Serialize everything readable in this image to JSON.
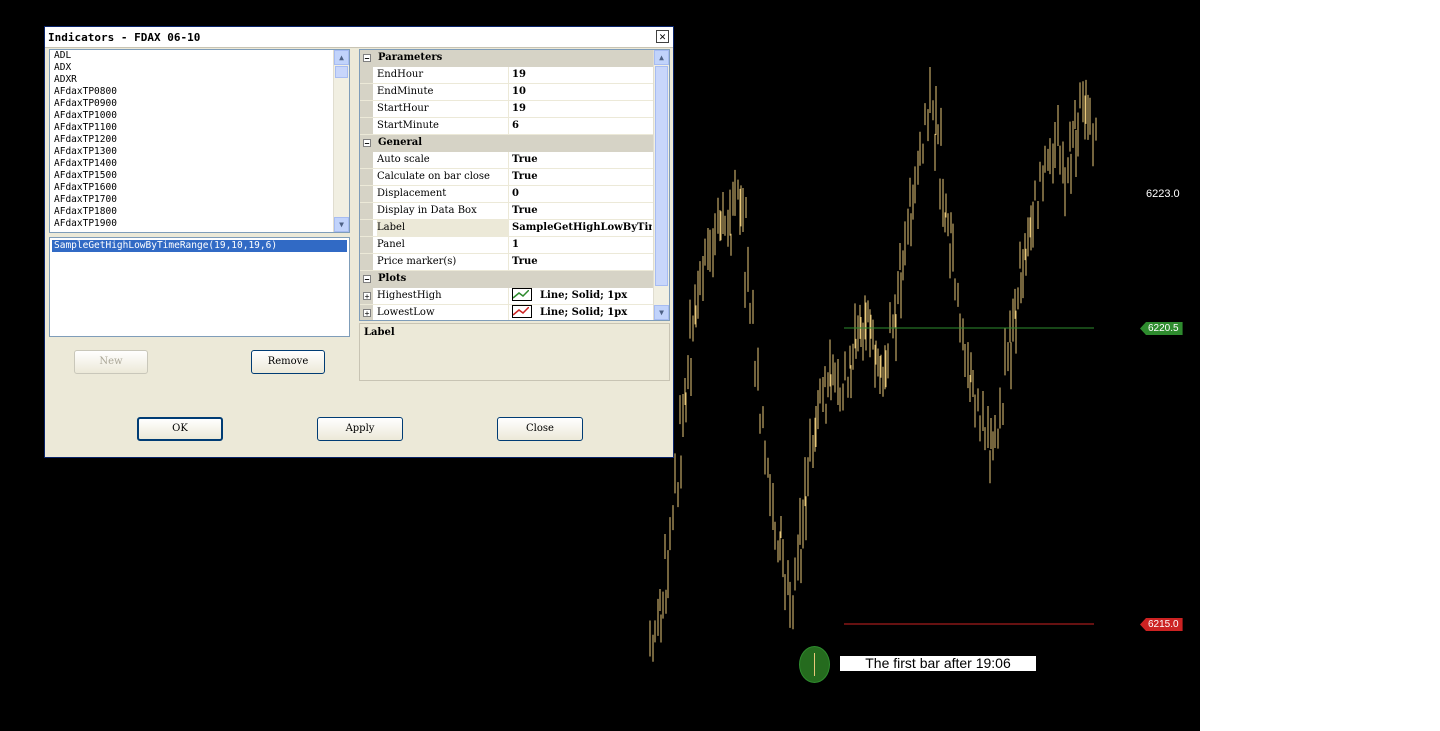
{
  "chart": {
    "price_axis_label": "6223.0",
    "highest_high_tag": "6220.5",
    "lowest_low_tag": "6215.0",
    "annotation": "The first bar after 19:06",
    "colors": {
      "bars": "#e8c87a",
      "highest_high_line": "#2e8b2e",
      "lowest_low_line": "#cc2222",
      "background": "#000000"
    }
  },
  "dialog": {
    "title": "Indicators - FDAX 06-10",
    "close_glyph": "✕",
    "indicator_list": [
      "ADL",
      "ADX",
      "ADXR",
      "AFdaxTP0800",
      "AFdaxTP0900",
      "AFdaxTP1000",
      "AFdaxTP1100",
      "AFdaxTP1200",
      "AFdaxTP1300",
      "AFdaxTP1400",
      "AFdaxTP1500",
      "AFdaxTP1600",
      "AFdaxTP1700",
      "AFdaxTP1800",
      "AFdaxTP1900"
    ],
    "applied": [
      "SampleGetHighLowByTimeRange(19,10,19,6)"
    ],
    "buttons": {
      "new": "New",
      "remove": "Remove",
      "ok": "OK",
      "apply": "Apply",
      "close": "Close"
    },
    "properties": {
      "parameters_title": "Parameters",
      "parameters": [
        {
          "key": "EndHour",
          "value": "19"
        },
        {
          "key": "EndMinute",
          "value": "10"
        },
        {
          "key": "StartHour",
          "value": "19"
        },
        {
          "key": "StartMinute",
          "value": "6"
        }
      ],
      "general_title": "General",
      "general": [
        {
          "key": "Auto scale",
          "value": "True"
        },
        {
          "key": "Calculate on bar close",
          "value": "True"
        },
        {
          "key": "Displacement",
          "value": "0"
        },
        {
          "key": "Display in Data Box",
          "value": "True"
        },
        {
          "key": "Label",
          "value": "SampleGetHighLowByTimeRange"
        },
        {
          "key": "Panel",
          "value": "1"
        },
        {
          "key": "Price marker(s)",
          "value": "True"
        }
      ],
      "plots_title": "Plots",
      "plots": [
        {
          "key": "HighestHigh",
          "value": "Line; Solid; 1px",
          "color": "#2e8b2e"
        },
        {
          "key": "LowestLow",
          "value": "Line; Solid; 1px",
          "color": "#cc2222"
        }
      ]
    },
    "description_title": "Label",
    "collapse_glyph": "−",
    "expand_glyph": "+"
  }
}
